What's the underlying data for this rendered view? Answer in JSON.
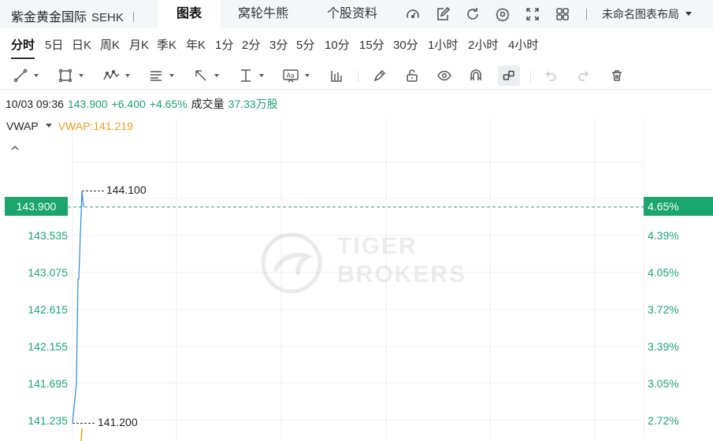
{
  "header": {
    "stock_name": "紫金黄金国际",
    "exchange": "SEHK",
    "tabs": [
      {
        "label": "图表",
        "active": true
      },
      {
        "label": "窝轮牛熊",
        "active": false
      },
      {
        "label": "个股资料",
        "active": false
      }
    ],
    "icons": [
      "gauge-icon",
      "pen-icon",
      "refresh-icon",
      "gear-icon",
      "fullscreen-icon",
      "grid-layout-icon"
    ],
    "layout_label": "未命名图表布局"
  },
  "periods": [
    {
      "label": "分时",
      "active": true
    },
    {
      "label": "5日"
    },
    {
      "label": "日K"
    },
    {
      "label": "周K"
    },
    {
      "label": "月K"
    },
    {
      "label": "季K"
    },
    {
      "label": "年K"
    },
    {
      "label": "1分"
    },
    {
      "label": "2分"
    },
    {
      "label": "3分"
    },
    {
      "label": "5分"
    },
    {
      "label": "10分"
    },
    {
      "label": "15分"
    },
    {
      "label": "30分"
    },
    {
      "label": "1小时"
    },
    {
      "label": "2小时"
    },
    {
      "label": "4小时"
    }
  ],
  "quote": {
    "time": "10/03 09:36",
    "price": "143.900",
    "change": "+6.400",
    "change_pct": "+4.65%",
    "volume_label": "成交量",
    "volume": "37.33万股"
  },
  "indicator": {
    "name": "VWAP",
    "value_text": "VWAP:141.219"
  },
  "watermark": {
    "line1": "TIGER",
    "line2": "BROKERS"
  },
  "colors": {
    "up": "#1aa56e",
    "vwap": "#f29d1f",
    "price_line": "#3a8ee6"
  },
  "chart_data": {
    "type": "line",
    "current_price": "143.900",
    "current_pct": "4.65%",
    "high_label": "144.100",
    "low_label": "141.200",
    "left_ticks": [
      "143.535",
      "143.075",
      "142.615",
      "142.155",
      "141.695",
      "141.235"
    ],
    "right_ticks": [
      "4.39%",
      "4.05%",
      "3.72%",
      "3.39%",
      "3.05%",
      "2.72%"
    ],
    "ylim": [
      141.0,
      144.4
    ],
    "series": [
      {
        "values": [
          {
            "t": 0,
            "y": 141.2
          },
          {
            "t": 1,
            "y": 141.6
          },
          {
            "t": 2,
            "y": 141.7
          },
          {
            "t": 3,
            "y": 143.0
          },
          {
            "t": 4,
            "y": 143.0
          },
          {
            "t": 5,
            "y": 144.1
          },
          {
            "t": 6,
            "y": 143.9
          }
        ]
      }
    ]
  }
}
